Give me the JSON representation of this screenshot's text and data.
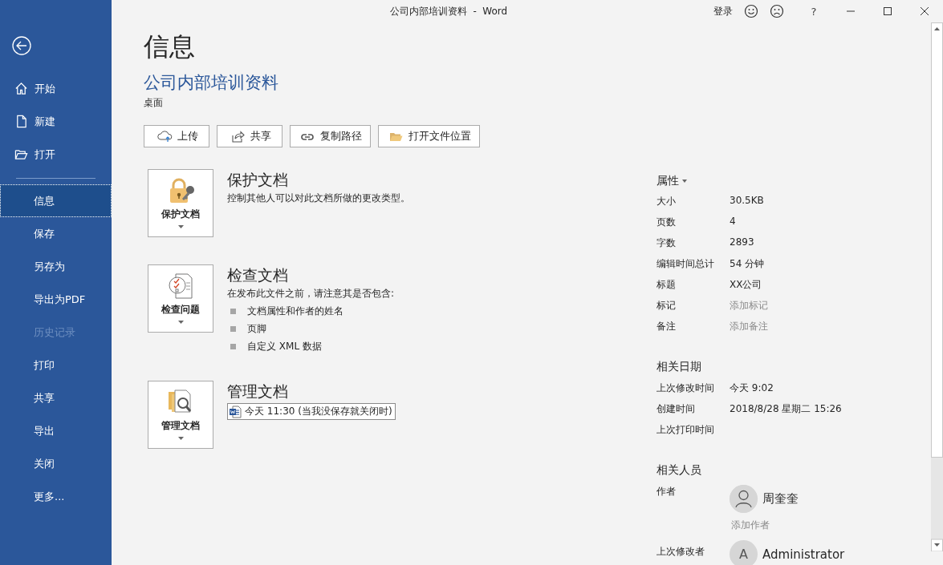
{
  "window": {
    "title": "公司内部培训资料  -  Word",
    "sign_in": "登录",
    "help": "?"
  },
  "sidebar": {
    "nav_items": [
      {
        "label": "开始"
      },
      {
        "label": "新建"
      },
      {
        "label": "打开"
      }
    ],
    "items": [
      {
        "label": "信息",
        "selected": true,
        "disabled": false
      },
      {
        "label": "保存",
        "selected": false,
        "disabled": false
      },
      {
        "label": "另存为",
        "selected": false,
        "disabled": false
      },
      {
        "label": "导出为PDF",
        "selected": false,
        "disabled": false
      },
      {
        "label": "历史记录",
        "selected": false,
        "disabled": true
      },
      {
        "label": "打印",
        "selected": false,
        "disabled": false
      },
      {
        "label": "共享",
        "selected": false,
        "disabled": false
      },
      {
        "label": "导出",
        "selected": false,
        "disabled": false
      },
      {
        "label": "关闭",
        "selected": false,
        "disabled": false
      },
      {
        "label": "更多...",
        "selected": false,
        "disabled": false
      }
    ]
  },
  "page": {
    "heading": "信息",
    "document_title": "公司内部培训资料",
    "location": "桌面",
    "actions": [
      {
        "label": "上传"
      },
      {
        "label": "共享"
      },
      {
        "label": "复制路径"
      },
      {
        "label": "打开文件位置"
      }
    ]
  },
  "sections": [
    {
      "tile_label": "保护文档",
      "title": "保护文档",
      "description": "控制其他人可以对此文档所做的更改类型。"
    },
    {
      "tile_label": "检查问题",
      "title": "检查文档",
      "description": "在发布此文件之前，请注意其是否包含:",
      "bullets": [
        "文档属性和作者的姓名",
        "页脚",
        "自定义 XML 数据"
      ]
    },
    {
      "tile_label": "管理文档",
      "title": "管理文档",
      "versions": [
        "今天 11:30 (当我没保存就关闭时)"
      ]
    }
  ],
  "properties": {
    "title": "属性",
    "rows": [
      {
        "label": "大小",
        "value": "30.5KB"
      },
      {
        "label": "页数",
        "value": "4"
      },
      {
        "label": "字数",
        "value": "2893"
      },
      {
        "label": "编辑时间总计",
        "value": "54 分钟"
      },
      {
        "label": "标题",
        "value": "XX公司"
      },
      {
        "label": "标记",
        "placeholder": "添加标记"
      },
      {
        "label": "备注",
        "placeholder": "添加备注"
      }
    ]
  },
  "related_dates": {
    "title": "相关日期",
    "rows": [
      {
        "label": "上次修改时间",
        "value": "今天 9:02"
      },
      {
        "label": "创建时间",
        "value": "2018/8/28 星期二 15:26"
      },
      {
        "label": "上次打印时间"
      }
    ]
  },
  "related_people": {
    "title": "相关人员",
    "author_label": "作者",
    "authors": [
      {
        "name": "周奎奎",
        "kind": "silhouette"
      }
    ],
    "add_author": "添加作者",
    "last_modified_label": "上次修改者",
    "last_modified_by": {
      "name": "Administrator",
      "initial": "A",
      "kind": "initial"
    }
  }
}
